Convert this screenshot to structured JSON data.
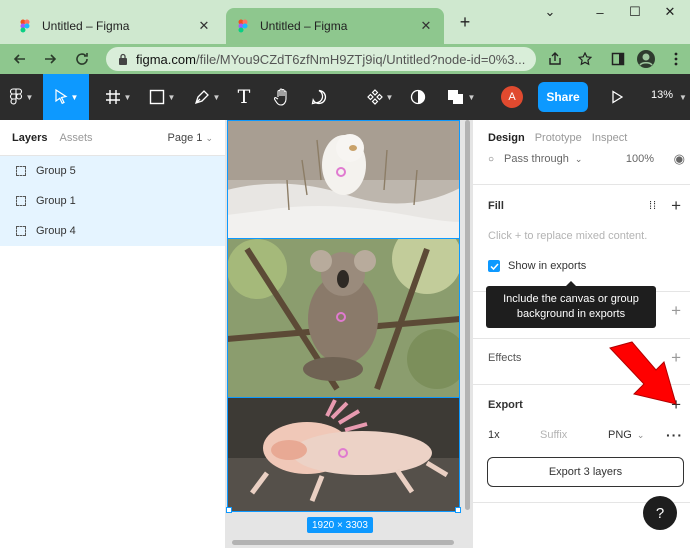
{
  "browser": {
    "tabs": [
      {
        "title": "Untitled – Figma",
        "active": false
      },
      {
        "title": "Untitled – Figma",
        "active": true
      }
    ],
    "new_tab_symbol": "+",
    "window_controls": {
      "minimize": "–",
      "maximize": "☐",
      "close": "✕"
    },
    "collapse_symbol": "⌄",
    "url_host": "figma.com",
    "url_path": "/file/MYou9CZdT6zfNmH9ZTj9iq/Untitled?node-id=0%3..."
  },
  "toolbar": {
    "share_label": "Share",
    "avatar_initial": "A",
    "zoom": "13%",
    "text_tool_glyph": "T"
  },
  "layers_panel": {
    "tabs": [
      "Layers",
      "Assets"
    ],
    "page_selector": "Page 1",
    "layers": [
      "Group 5",
      "Group 1",
      "Group 4"
    ]
  },
  "canvas": {
    "dimensions_label": "1920 × 3303"
  },
  "design_panel": {
    "tabs": [
      "Design",
      "Prototype",
      "Inspect"
    ],
    "blend_mode": "Pass through",
    "opacity": "100%",
    "fill_heading": "Fill",
    "fill_hint": "Click + to replace mixed content.",
    "show_in_exports": "Show in exports",
    "tooltip": "Include the canvas or group background in exports",
    "effects_heading": "Effects",
    "export_heading": "Export",
    "export_scale": "1x",
    "export_suffix_placeholder": "Suffix",
    "export_format": "PNG",
    "export_button": "Export 3 layers",
    "help_symbol": "?"
  },
  "colors": {
    "accent": "#0d99ff",
    "toolbar_bg": "#2c2c2c",
    "browser_bg": "#cfe8cf",
    "arrow": "#ff0000"
  }
}
